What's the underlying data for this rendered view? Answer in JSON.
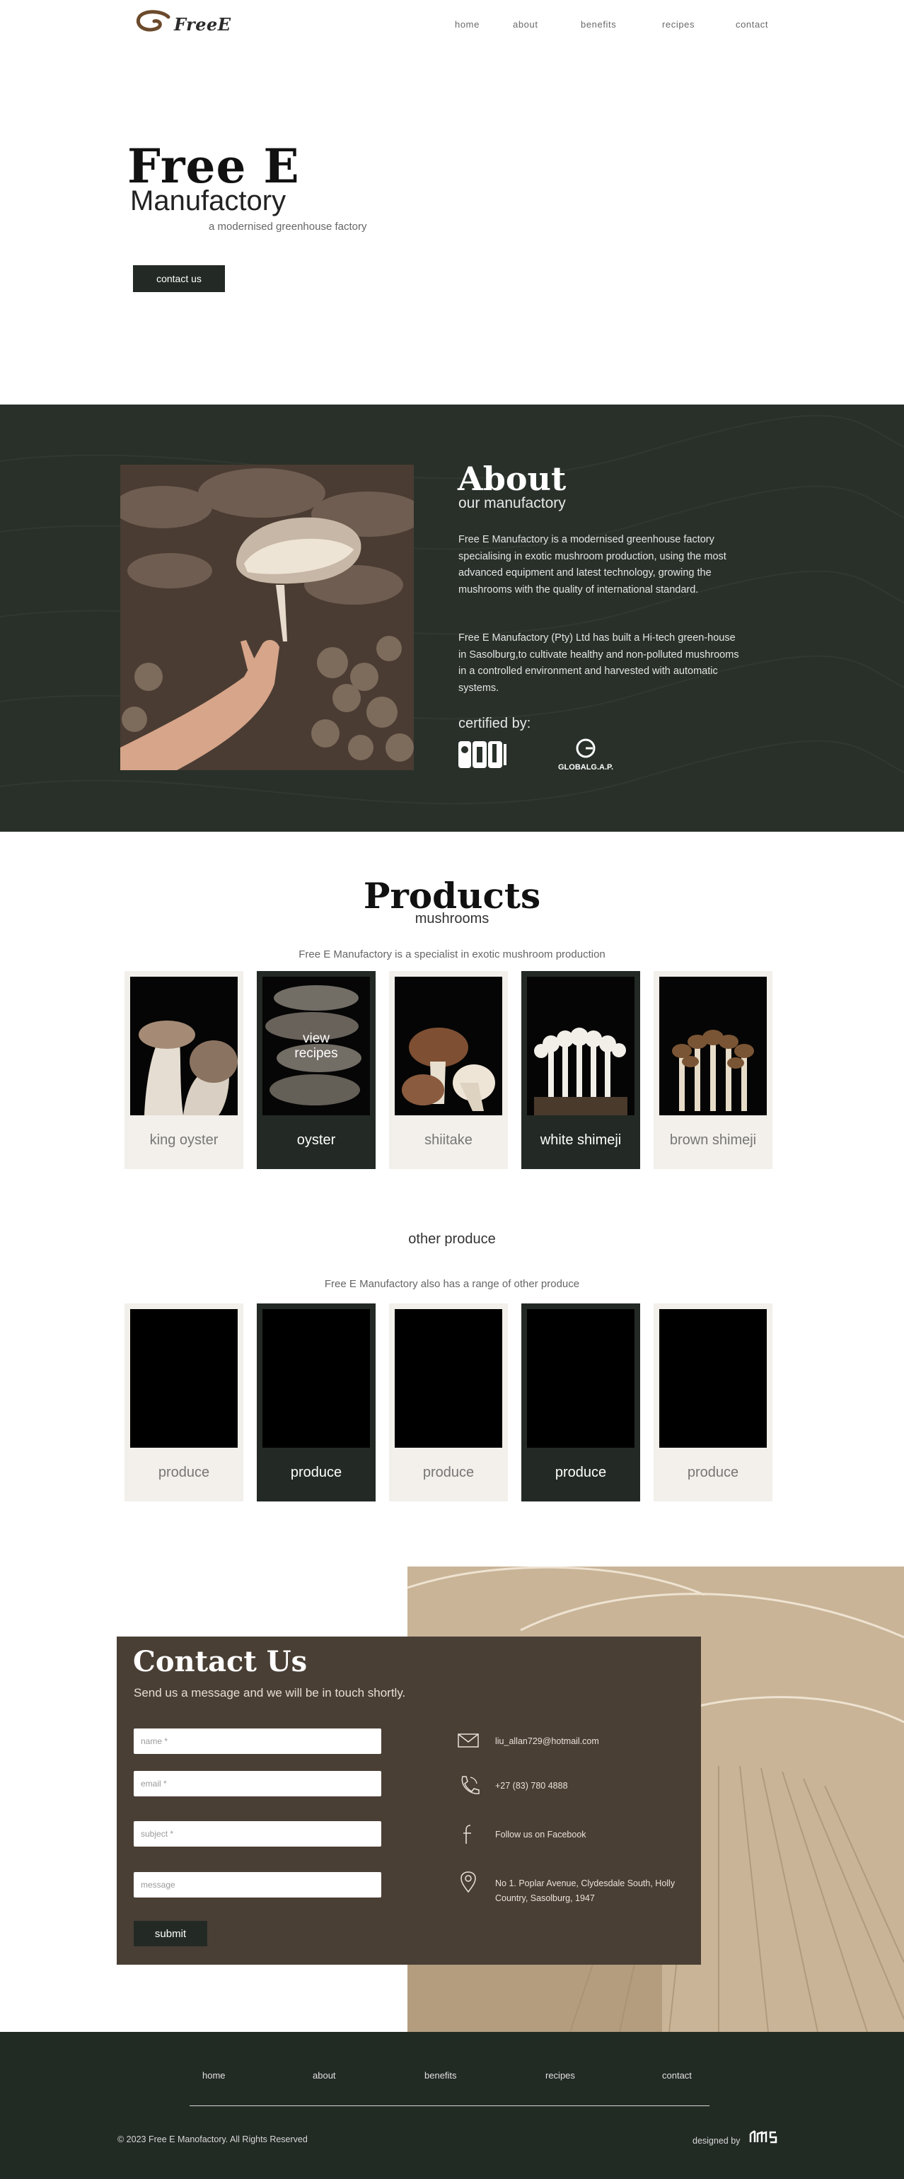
{
  "nav": {
    "logo_text": "FreeE",
    "links": [
      "home",
      "about",
      "benefits",
      "recipes",
      "contact"
    ]
  },
  "hero": {
    "title": "Free E",
    "subtitle": "Manufactory",
    "tagline": "a modernised greenhouse factory",
    "cta": "contact us"
  },
  "about": {
    "title": "About",
    "subtitle": "our manufactory",
    "paragraph1": "Free E Manufactory is a modernised greenhouse factory specialising in exotic mushroom production, using the most advanced equipment and latest technology, growing the mushrooms with the quality of international standard.",
    "paragraph2": "Free E Manufactory (Pty) Ltd has built a Hi-tech green-house in Sasolburg,to cultivate healthy and non-polluted mushrooms in a controlled environment and harvested with automatic systems.",
    "certified_label": "certified by:",
    "cert2_text": "GLOBALG.A.P."
  },
  "products": {
    "title": "Products",
    "subtitle": "mushrooms",
    "description": "Free E Manufactory is a specialist in exotic mushroom production",
    "overlay_text": "view recipes",
    "items": [
      "king oyster",
      "oyster",
      "shiitake",
      "white shimeji",
      "brown shimeji"
    ]
  },
  "other": {
    "subtitle": "other produce",
    "description": "Free E Manufactory also has a range of other produce",
    "items": [
      "produce",
      "produce",
      "produce",
      "produce",
      "produce"
    ]
  },
  "contact": {
    "title": "Contact Us",
    "subtitle": "Send us a message and we will be in touch shortly.",
    "name_placeholder": "name *",
    "email_placeholder": "email *",
    "subject_placeholder": "subject *",
    "message_placeholder": "message",
    "submit_label": "submit",
    "email": "liu_allan729@hotmail.com",
    "phone": "+27 (83) 780 4888",
    "facebook": "Follow us on Facebook",
    "address": "No 1. Poplar Avenue, Clydesdale South, Holly Country, Sasolburg, 1947"
  },
  "footer": {
    "links": [
      "home",
      "about",
      "benefits",
      "recipes",
      "contact"
    ],
    "copyright": "© 2023 Free E Manofactory. All Rights Reserved",
    "designed_by": "designed by"
  },
  "colors": {
    "dark_green": "#283029",
    "button_dark": "#232a25",
    "card_light": "#f3efea",
    "contact_brown": "#4a3f35"
  }
}
